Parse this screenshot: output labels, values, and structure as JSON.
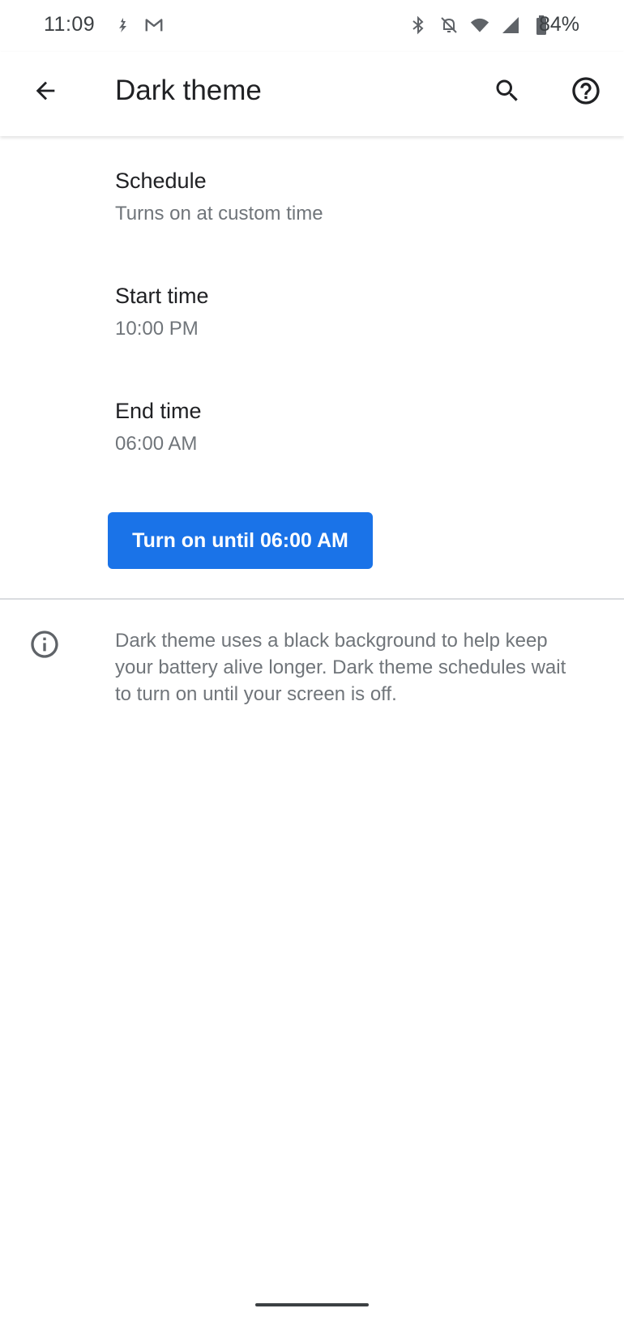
{
  "status_bar": {
    "time": "11:09",
    "battery_percent": "84%",
    "left_icons": [
      "pac-man-icon",
      "gmail-icon"
    ],
    "right_icons": [
      "bluetooth-icon",
      "notifications-off-icon",
      "wifi-icon",
      "cell-signal-icon",
      "battery-icon"
    ]
  },
  "app_bar": {
    "title": "Dark theme",
    "back_icon": "arrow-back-icon",
    "search_icon": "search-icon",
    "help_icon": "help-icon"
  },
  "preferences": [
    {
      "title": "Schedule",
      "summary": "Turns on at custom time"
    },
    {
      "title": "Start time",
      "summary": "10:00 PM"
    },
    {
      "title": "End time",
      "summary": "06:00 AM"
    }
  ],
  "action_button": {
    "label": "Turn on until 06:00 AM",
    "color": "#1a73e8"
  },
  "footer_info": {
    "icon": "info-icon",
    "text": "Dark theme uses a black background to help keep your battery alive longer. Dark theme schedules wait to turn on until your screen is off."
  }
}
